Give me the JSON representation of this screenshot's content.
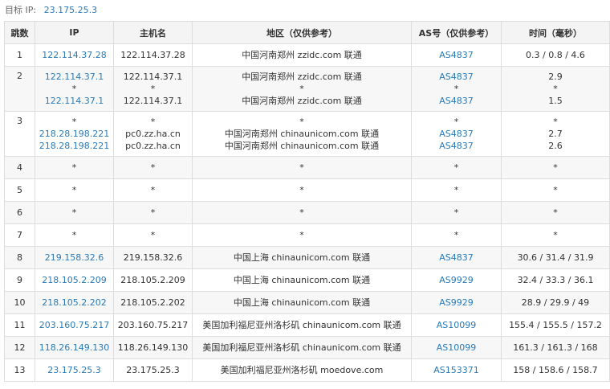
{
  "target": {
    "label": "目标 IP:",
    "value": "23.175.25.3"
  },
  "headers": [
    "跳数",
    "IP",
    "主机名",
    "地区（仅供参考）",
    "AS号（仅供参考）",
    "时间（毫秒）"
  ],
  "rows": [
    {
      "hop": "1",
      "ip": [
        "122.114.37.28"
      ],
      "host": [
        "122.114.37.28"
      ],
      "region": [
        "中国河南郑州 zzidc.com 联通"
      ],
      "as": [
        "AS4837"
      ],
      "time": [
        "0.3 / 0.8 / 4.6"
      ]
    },
    {
      "hop": "2",
      "ip": [
        "122.114.37.1",
        "*",
        "122.114.37.1"
      ],
      "host": [
        "122.114.37.1",
        "*",
        "122.114.37.1"
      ],
      "region": [
        "中国河南郑州 zzidc.com 联通",
        "*",
        "中国河南郑州 zzidc.com 联通"
      ],
      "as": [
        "AS4837",
        "*",
        "AS4837"
      ],
      "time": [
        "2.9",
        "*",
        "1.5"
      ]
    },
    {
      "hop": "3",
      "ip": [
        "*",
        "218.28.198.221",
        "218.28.198.221"
      ],
      "host": [
        "*",
        "pc0.zz.ha.cn",
        "pc0.zz.ha.cn"
      ],
      "region": [
        "*",
        "中国河南郑州 chinaunicom.com 联通",
        "中国河南郑州 chinaunicom.com 联通"
      ],
      "as": [
        "*",
        "AS4837",
        "AS4837"
      ],
      "time": [
        "*",
        "2.7",
        "2.6"
      ]
    },
    {
      "hop": "4",
      "ip": [
        "*"
      ],
      "host": [
        "*"
      ],
      "region": [
        "*"
      ],
      "as": [
        "*"
      ],
      "time": [
        "*"
      ]
    },
    {
      "hop": "5",
      "ip": [
        "*"
      ],
      "host": [
        "*"
      ],
      "region": [
        "*"
      ],
      "as": [
        "*"
      ],
      "time": [
        "*"
      ]
    },
    {
      "hop": "6",
      "ip": [
        "*"
      ],
      "host": [
        "*"
      ],
      "region": [
        "*"
      ],
      "as": [
        "*"
      ],
      "time": [
        "*"
      ]
    },
    {
      "hop": "7",
      "ip": [
        "*"
      ],
      "host": [
        "*"
      ],
      "region": [
        "*"
      ],
      "as": [
        "*"
      ],
      "time": [
        "*"
      ]
    },
    {
      "hop": "8",
      "ip": [
        "219.158.32.6"
      ],
      "host": [
        "219.158.32.6"
      ],
      "region": [
        "中国上海 chinaunicom.com 联通"
      ],
      "as": [
        "AS4837"
      ],
      "time": [
        "30.6 / 31.4 / 31.9"
      ]
    },
    {
      "hop": "9",
      "ip": [
        "218.105.2.209"
      ],
      "host": [
        "218.105.2.209"
      ],
      "region": [
        "中国上海 chinaunicom.com 联通"
      ],
      "as": [
        "AS9929"
      ],
      "time": [
        "32.4 / 33.3 / 36.1"
      ]
    },
    {
      "hop": "10",
      "ip": [
        "218.105.2.202"
      ],
      "host": [
        "218.105.2.202"
      ],
      "region": [
        "中国上海 chinaunicom.com 联通"
      ],
      "as": [
        "AS9929"
      ],
      "time": [
        "28.9 / 29.9 / 49"
      ]
    },
    {
      "hop": "11",
      "ip": [
        "203.160.75.217"
      ],
      "host": [
        "203.160.75.217"
      ],
      "region": [
        "美国加利福尼亚州洛杉矶 chinaunicom.com 联通"
      ],
      "as": [
        "AS10099"
      ],
      "time": [
        "155.4 / 155.5 / 157.2"
      ]
    },
    {
      "hop": "12",
      "ip": [
        "118.26.149.130"
      ],
      "host": [
        "118.26.149.130"
      ],
      "region": [
        "美国加利福尼亚州洛杉矶 chinaunicom.com 联通"
      ],
      "as": [
        "AS10099"
      ],
      "time": [
        "161.3 / 161.3 / 168"
      ]
    },
    {
      "hop": "13",
      "ip": [
        "23.175.25.3"
      ],
      "host": [
        "23.175.25.3"
      ],
      "region": [
        "美国加利福尼亚州洛杉矶 moedove.com"
      ],
      "as": [
        "AS153371"
      ],
      "time": [
        "158 / 158.6 / 158.7"
      ]
    }
  ],
  "colors": {
    "link": "#2a7ab8",
    "border": "#dddddd",
    "header_bg": "#f4f4f4",
    "stripe_bg": "#f7f7f7"
  }
}
